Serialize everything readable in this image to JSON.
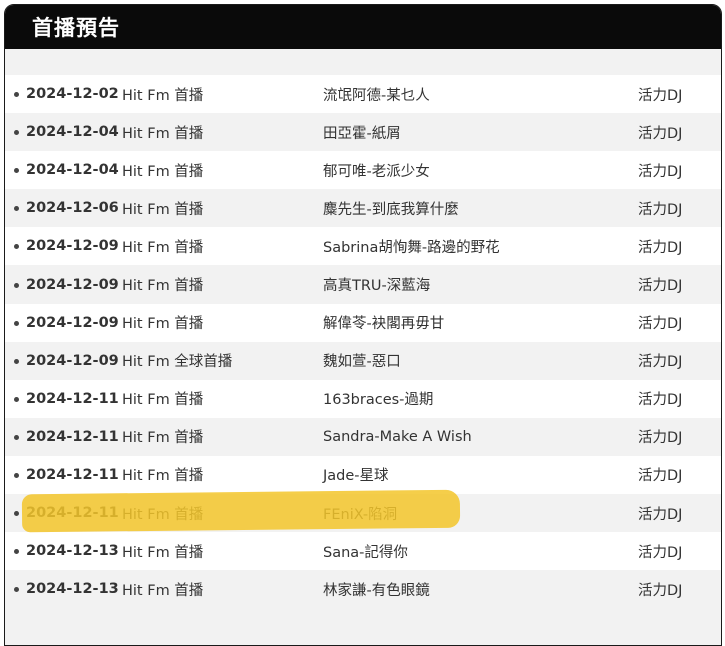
{
  "header": {
    "title": "首播預告"
  },
  "accent_color": "#f3c52a",
  "rows": [
    {
      "date": "2024-12-02",
      "station": "Hit Fm 首播",
      "song": "流氓阿德-某乜人",
      "dj": "活力DJ"
    },
    {
      "date": "2024-12-04",
      "station": "Hit Fm 首播",
      "song": "田亞霍-紙屑",
      "dj": "活力DJ"
    },
    {
      "date": "2024-12-04",
      "station": "Hit Fm 首播",
      "song": "郁可唯-老派少女",
      "dj": "活力DJ"
    },
    {
      "date": "2024-12-06",
      "station": "Hit Fm 首播",
      "song": "麋先生-到底我算什麼",
      "dj": "活力DJ"
    },
    {
      "date": "2024-12-09",
      "station": "Hit Fm 首播",
      "song": "Sabrina胡恂舞-路邊的野花",
      "dj": "活力DJ"
    },
    {
      "date": "2024-12-09",
      "station": "Hit Fm 首播",
      "song": "高真TRU-深藍海",
      "dj": "活力DJ"
    },
    {
      "date": "2024-12-09",
      "station": "Hit Fm 首播",
      "song": "解偉苓-袂閣再毋甘",
      "dj": "活力DJ"
    },
    {
      "date": "2024-12-09",
      "station": "Hit Fm 全球首播",
      "song": "魏如萱-惡口",
      "dj": "活力DJ"
    },
    {
      "date": "2024-12-11",
      "station": "Hit Fm 首播",
      "song": "163braces-過期",
      "dj": "活力DJ"
    },
    {
      "date": "2024-12-11",
      "station": "Hit Fm 首播",
      "song": "Sandra-Make A Wish",
      "dj": "活力DJ"
    },
    {
      "date": "2024-12-11",
      "station": "Hit Fm 首播",
      "song": "Jade-星球",
      "dj": "活力DJ"
    },
    {
      "date": "2024-12-11",
      "station": "Hit Fm 首播",
      "song": "FEniX-陷洞",
      "dj": "活力DJ"
    },
    {
      "date": "2024-12-13",
      "station": "Hit Fm 首播",
      "song": "Sana-記得你",
      "dj": "活力DJ"
    },
    {
      "date": "2024-12-13",
      "station": "Hit Fm 首播",
      "song": "林家謙-有色眼鏡",
      "dj": "活力DJ"
    }
  ]
}
